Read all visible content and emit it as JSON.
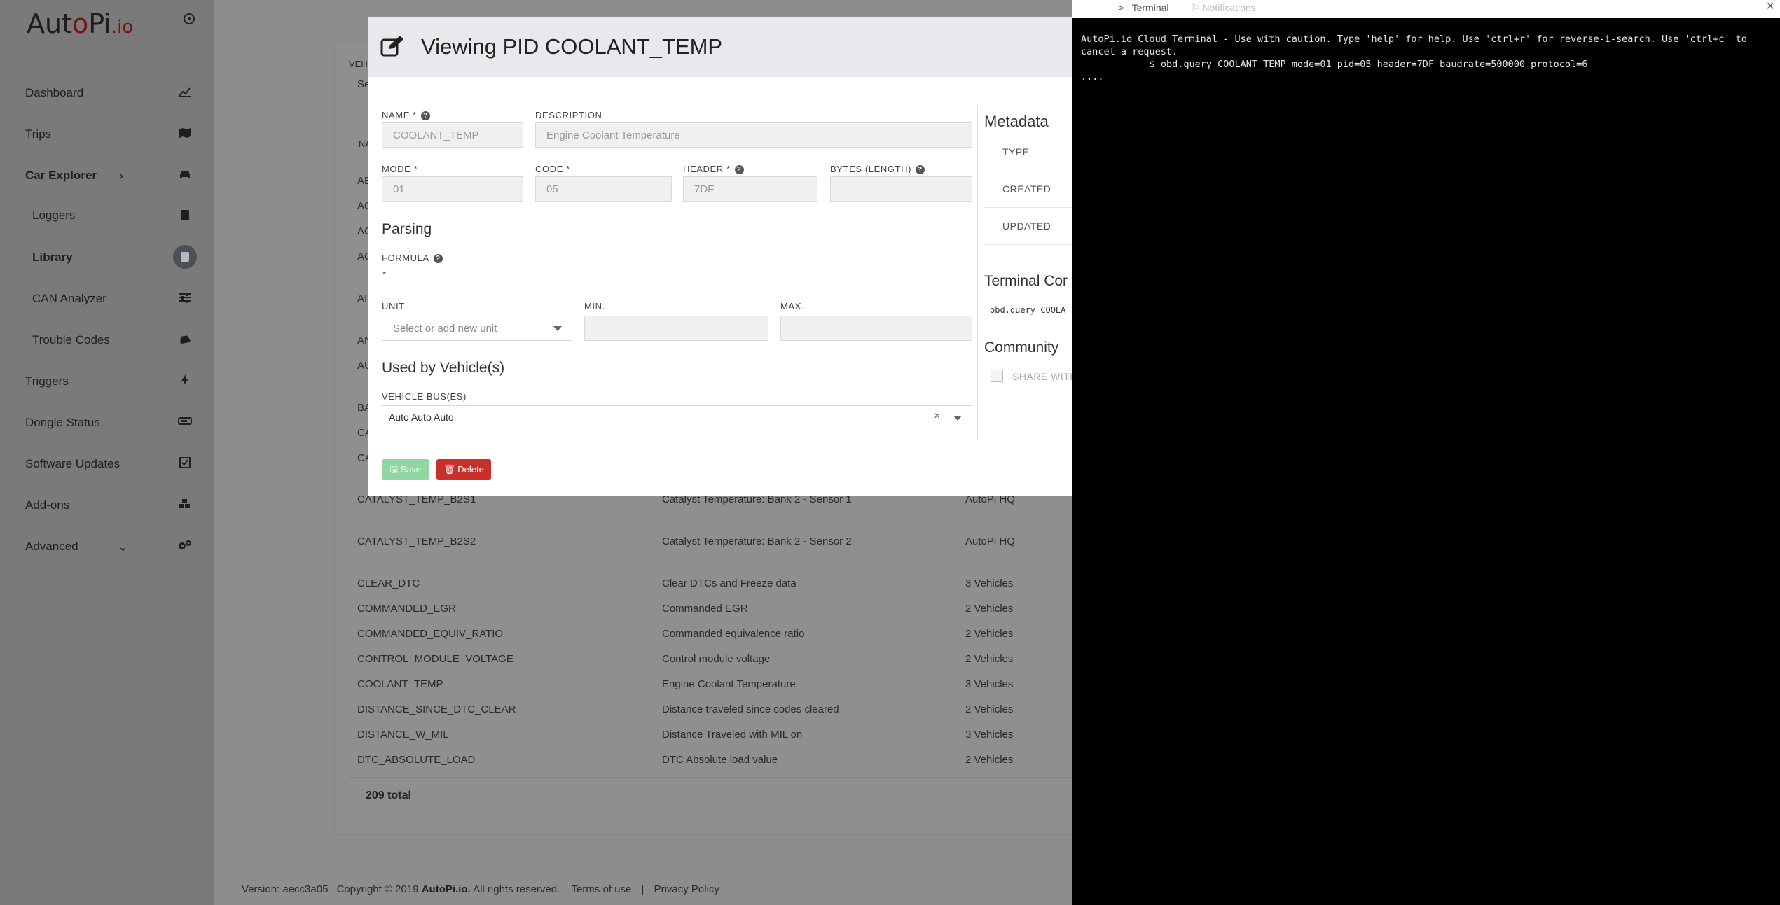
{
  "sidebar": {
    "logo": {
      "part1": "Aut",
      "dot": "o",
      "part2": "Pi",
      "tld": ".io"
    },
    "items": [
      {
        "label": "Dashboard",
        "icon": "chart-line-icon"
      },
      {
        "label": "Trips",
        "icon": "map-icon"
      },
      {
        "label": "Car Explorer",
        "icon": "car-icon"
      },
      {
        "label": "Loggers",
        "icon": "clipboard-icon"
      },
      {
        "label": "Library",
        "icon": "book-icon"
      },
      {
        "label": "CAN Analyzer",
        "icon": "sliders-icon"
      },
      {
        "label": "Trouble Codes",
        "icon": "car-crash-icon"
      },
      {
        "label": "Triggers",
        "icon": "bolt-icon"
      },
      {
        "label": "Dongle Status",
        "icon": "dongle-icon"
      },
      {
        "label": "Software Updates",
        "icon": "check-square-icon"
      },
      {
        "label": "Add-ons",
        "icon": "cubes-icon"
      },
      {
        "label": "Advanced",
        "icon": "cogs-icon"
      }
    ]
  },
  "background": {
    "partial": {
      "veh": "VEH",
      "sel": "Se",
      "na": "NA",
      "letters": [
        "AB",
        "AC",
        "AC",
        "AC",
        "AI",
        "AN",
        "AU",
        "BA",
        "CA",
        "CA"
      ]
    },
    "rows": [
      {
        "name": "CATALYST_TEMP_B2S1",
        "description": "Catalyst Temperature: Bank 2 - Sensor 1",
        "used_by": "AutoPi HQ"
      },
      {
        "name": "CATALYST_TEMP_B2S2",
        "description": "Catalyst Temperature: Bank 2 - Sensor 2",
        "used_by": "AutoPi HQ"
      },
      {
        "name": "CLEAR_DTC",
        "description": "Clear DTCs and Freeze data",
        "used_by": "3 Vehicles"
      },
      {
        "name": "COMMANDED_EGR",
        "description": "Commanded EGR",
        "used_by": "2 Vehicles"
      },
      {
        "name": "COMMANDED_EQUIV_RATIO",
        "description": "Commanded equivalence ratio",
        "used_by": "2 Vehicles"
      },
      {
        "name": "CONTROL_MODULE_VOLTAGE",
        "description": "Control module voltage",
        "used_by": "2 Vehicles"
      },
      {
        "name": "COOLANT_TEMP",
        "description": "Engine Coolant Temperature",
        "used_by": "3 Vehicles"
      },
      {
        "name": "DISTANCE_SINCE_DTC_CLEAR",
        "description": "Distance traveled since codes cleared",
        "used_by": "2 Vehicles"
      },
      {
        "name": "DISTANCE_W_MIL",
        "description": "Distance Traveled with MIL on",
        "used_by": "3 Vehicles"
      },
      {
        "name": "DTC_ABSOLUTE_LOAD",
        "description": "DTC Absolute load value",
        "used_by": "2 Vehicles"
      }
    ],
    "total": "209 total"
  },
  "footer": {
    "version": "Version: aecc3a05",
    "copyright": "Copyright © 2019",
    "brand": "AutoPi.io.",
    "rights": "All rights reserved.",
    "terms": "Terms of use",
    "separator": "|",
    "privacy": "Privacy Policy"
  },
  "modal": {
    "title": "Viewing PID COOLANT_TEMP",
    "name_label": "NAME *",
    "name_value": "COOLANT_TEMP",
    "description_label": "DESCRIPTION",
    "description_value": "Engine Coolant Temperature",
    "mode_label": "MODE *",
    "mode_value": "01",
    "code_label": "CODE *",
    "code_value": "05",
    "header_label": "HEADER *",
    "header_value": "7DF",
    "bytes_label": "BYTES (LENGTH)",
    "bytes_value": "",
    "parsing_title": "Parsing",
    "formula_label": "FORMULA",
    "formula_value": "-",
    "unit_label": "UNIT",
    "unit_placeholder": "Select or add new unit",
    "min_label": "MIN.",
    "min_value": "",
    "max_label": "MAX.",
    "max_value": "",
    "used_by_title": "Used by Vehicle(s)",
    "vehicle_bus_label": "VEHICLE BUS(ES)",
    "vehicle_bus_tags": [
      "Auto",
      "Auto",
      "Auto"
    ],
    "clear_symbol": "×",
    "save_label": "Save",
    "delete_label": "Delete",
    "metadata_title": "Metadata",
    "meta_type": "TYPE",
    "meta_created": "CREATED",
    "meta_updated": "UPDATED",
    "terminal_command_title": "Terminal Cor",
    "terminal_command_value": "obd.query COOLA",
    "community_title": "Community",
    "share_label": "SHARE WITH"
  },
  "terminal": {
    "tab_terminal": "Terminal",
    "tab_notifications": "Notifications",
    "close": "×",
    "line1": "AutoPi.io Cloud Terminal - Use with caution. Type 'help' for help. Use 'ctrl+r' for reverse-i-search. Use 'ctrl+c' to",
    "line2": "cancel a request.",
    "prompt_symbol": "$",
    "command": "obd.query COOLANT_TEMP mode=01 pid=05 header=7DF baudrate=500000 protocol=6",
    "line4": "...."
  }
}
